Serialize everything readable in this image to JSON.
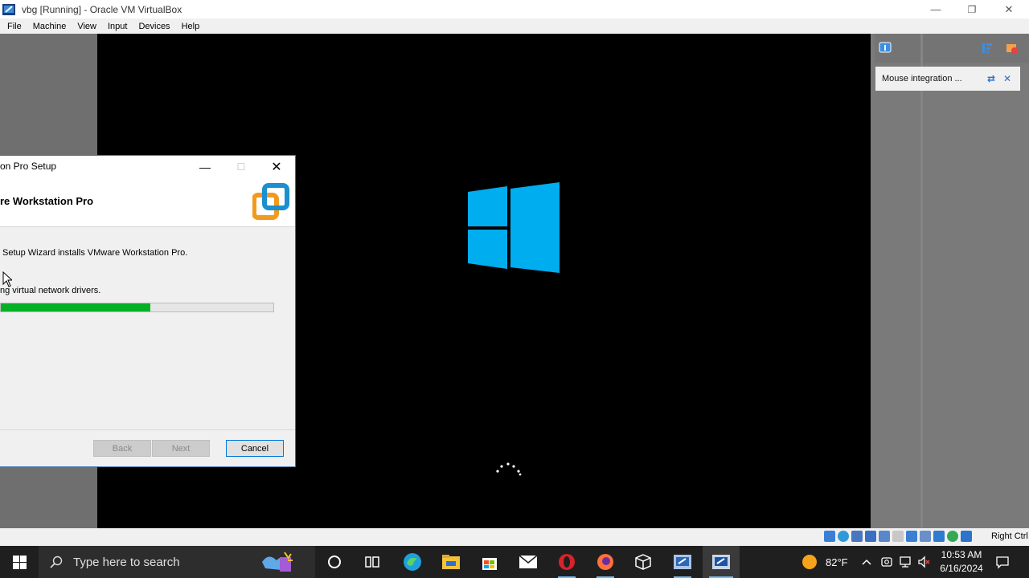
{
  "window": {
    "title": "vbg [Running] - Oracle VM VirtualBox",
    "controls": {
      "minimize": "—",
      "restore": "❐",
      "close": "✕"
    }
  },
  "menu": {
    "items": [
      "File",
      "Machine",
      "View",
      "Input",
      "Devices",
      "Help"
    ]
  },
  "notification": {
    "text": "Mouse integration ..."
  },
  "statusbar": {
    "host_key": "Right Ctrl"
  },
  "setup_dialog": {
    "title": "on Pro Setup",
    "heading": "re Workstation Pro",
    "description": "Setup Wizard installs VMware Workstation Pro.",
    "status": "ng virtual network drivers.",
    "progress": 0.55,
    "buttons": {
      "back": "Back",
      "next": "Next",
      "cancel": "Cancel"
    }
  },
  "taskbar": {
    "search_placeholder": "Type here to search",
    "temperature": "82°F",
    "time": "10:53 AM",
    "date": "6/16/2024"
  },
  "colors": {
    "windows_logo": "#00adef",
    "progress_fill": "#06b025",
    "accent": "#0078d7",
    "vmware_orange": "#f29a1f",
    "vmware_blue": "#1b8fcf"
  }
}
